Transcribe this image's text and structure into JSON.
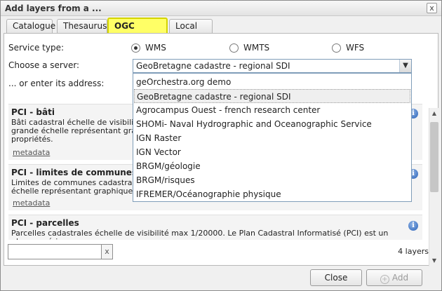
{
  "window": {
    "title": "Add layers from a ...",
    "close_label": "x"
  },
  "tabs": [
    {
      "label": "Catalogue"
    },
    {
      "label": "Thesaurus"
    },
    {
      "label": "OGC server"
    },
    {
      "label": "Local file"
    }
  ],
  "form": {
    "service_type_label": "Service type:",
    "service_options": [
      {
        "label": "WMS",
        "selected": true
      },
      {
        "label": "WMTS",
        "selected": false
      },
      {
        "label": "WFS",
        "selected": false
      }
    ],
    "server_label": "Choose a server:",
    "selected_server": "GeoBretagne cadastre - regional SDI",
    "address_label": "... or enter its address:"
  },
  "dropdown": {
    "items": [
      "geOrchestra.org demo",
      "GeoBretagne cadastre - regional SDI",
      "Agrocampus Ouest - french research center",
      "SHOMi- Naval Hydrographic and Oceanographic Service",
      "IGN Raster",
      "IGN Vector",
      "BRGM/géologie",
      "BRGM/risques",
      "IFREMER/Océanographie physique"
    ],
    "selected_index": 1
  },
  "layers": [
    {
      "title": "PCI - bâti",
      "desc_lines": [
        "Bâti cadastral échelle de visibilité m",
        "grande échelle représentant graphi",
        "propriétés."
      ],
      "link": "metadata"
    },
    {
      "title": "PCI - limites de communes",
      "desc_lines": [
        "Limites de communes cadastrales. L",
        "échelle représentant graphiquemer"
      ],
      "link": "metadata"
    },
    {
      "title": "PCI - parcelles",
      "desc_lines": [
        "Parcelles cadastrales échelle de visibilité max 1/20000. Le Plan Cadastral Informatisé (PCI) est un plan numérique"
      ],
      "link": ""
    }
  ],
  "footer": {
    "search_value": "",
    "clear_label": "x",
    "count_label": "4 layers",
    "close_button": "Close",
    "add_button": "Add"
  }
}
